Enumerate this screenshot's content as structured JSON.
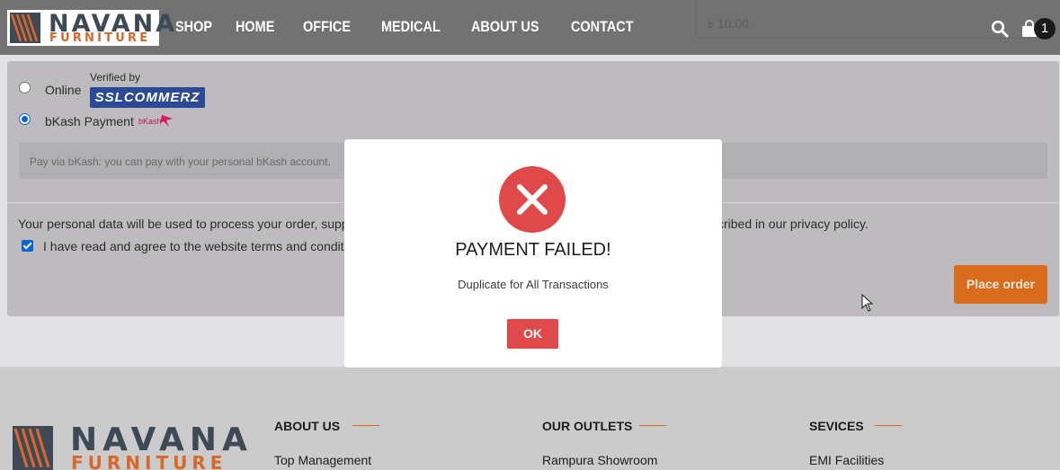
{
  "header": {
    "logo": {
      "name": "NAVANA",
      "sub": "FURNITURE"
    },
    "nav": [
      "SHOP",
      "HOME",
      "OFFICE",
      "MEDICAL",
      "ABOUT US",
      "CONTACT"
    ],
    "cart_total": "৳ 10.00",
    "cart_count": "1"
  },
  "checkout": {
    "methods": [
      {
        "label": "Online",
        "checked": false
      },
      {
        "label": "bKash Payment",
        "checked": true
      }
    ],
    "verified_by": "Verified by",
    "ssl_badge": "SSLCOMMERZ",
    "bkash_logo_text": "bKash",
    "bkash_desc": "Pay via bKash: you can pay with your personal bKash account.",
    "privacy_text": "Your personal data will be used to process your order, suppor",
    "privacy_tail": "cribed in our privacy policy.",
    "terms_text": "I have read and agree to the website terms and conditions",
    "place_order": "Place order"
  },
  "modal": {
    "title": "PAYMENT FAILED!",
    "message": "Duplicate for All Transactions",
    "ok": "OK"
  },
  "footer": {
    "logo": {
      "name": "NAVANA",
      "sub": "FURNITURE"
    },
    "columns": [
      {
        "heading": "ABOUT US",
        "first_link": "Top Management"
      },
      {
        "heading": "OUR OUTLETS",
        "first_link": "Rampura Showroom"
      },
      {
        "heading": "SEVICES",
        "first_link": "EMI Facilities"
      }
    ]
  },
  "colors": {
    "accent": "#d96b1c",
    "error": "#e0494a",
    "header_bg": "#727272"
  }
}
